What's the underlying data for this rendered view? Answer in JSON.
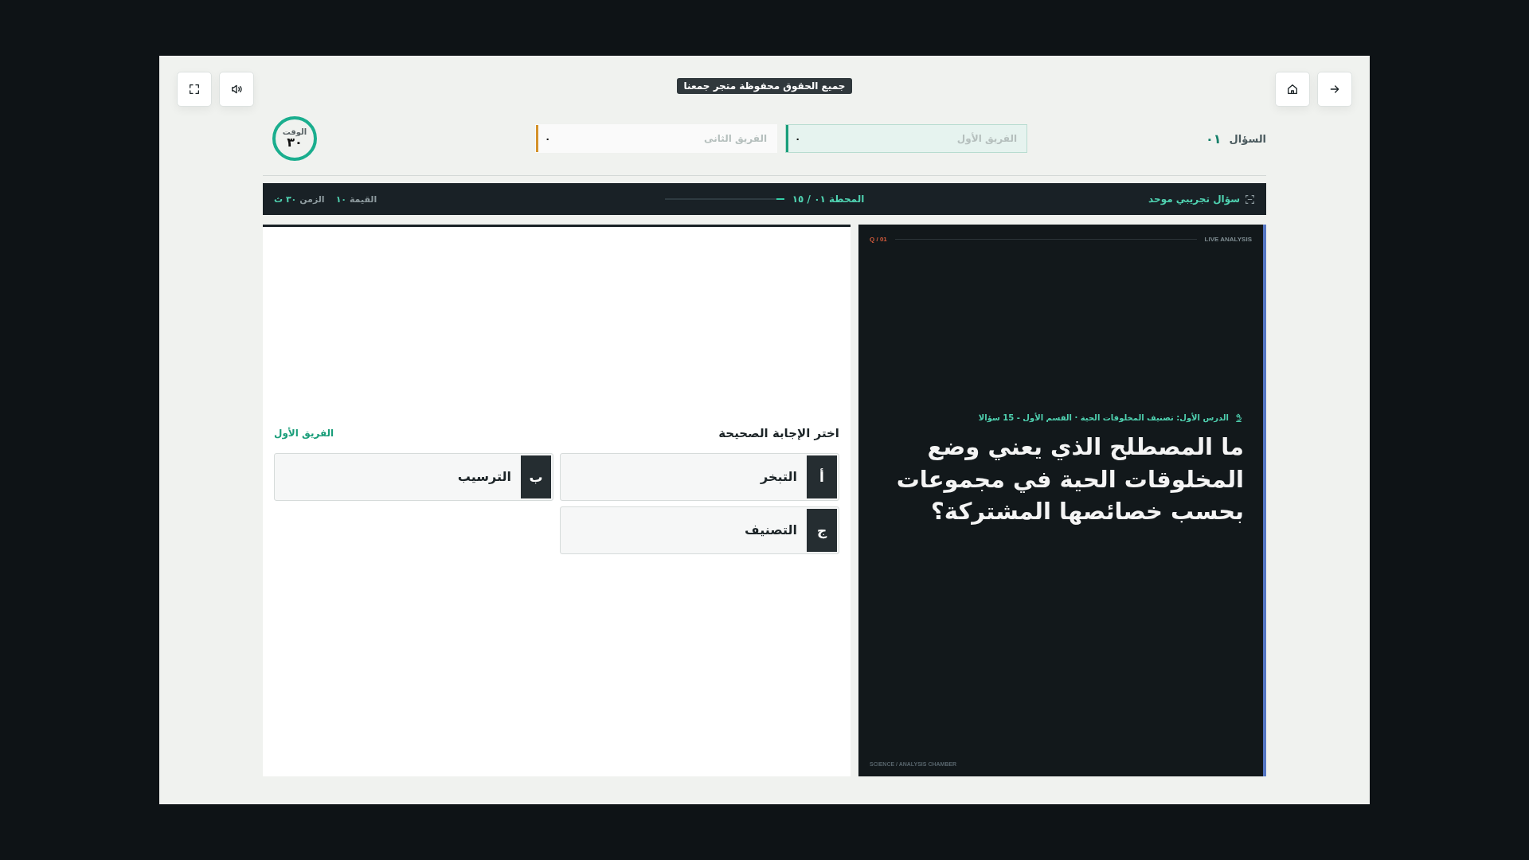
{
  "header": {
    "copyright": "جميع الحقوق محفوظة متجر جمعنا"
  },
  "question_number": {
    "label": "السؤال",
    "value": "٠١"
  },
  "teams": [
    {
      "name": "الفريق الأول",
      "score": "٠",
      "color": "#1a9e7a",
      "active": true
    },
    {
      "name": "الفريق الثانى",
      "score": "٠",
      "color": "#d4922a",
      "active": false
    }
  ],
  "timer": {
    "label": "الوقت",
    "value": "٣٠"
  },
  "status_bar": {
    "title": "سؤال تجريبي موحد",
    "station": "المحطة ٠١ / ١٥",
    "level": 0.067,
    "value_label": "القيمة",
    "value": "١٠",
    "time_label": "الزمن",
    "time": "٣٠ ث"
  },
  "question_card": {
    "number": "Q / 01",
    "tag": "LIVE ANALYSIS",
    "lesson": "الدرس الأول: تصنيف المخلوقات الحية · القسم الأول - 15 سؤالا",
    "question": "ما المصطلح الذي يعني وضع المخلوقات الحية في مجموعات بحسب خصائصها المشتركة؟",
    "footer": "SCIENCE / ANALYSIS CHAMBER"
  },
  "answers": {
    "prompt": "اختر الإجابة الصحيحة",
    "turn": "الفريق الأول",
    "options": [
      {
        "letter": "أ",
        "text": "التبخر",
        "selected": false
      },
      {
        "letter": "ب",
        "text": "الترسيب",
        "selected": false
      },
      {
        "letter": "ج",
        "text": "التصنيف",
        "selected": false
      }
    ]
  }
}
